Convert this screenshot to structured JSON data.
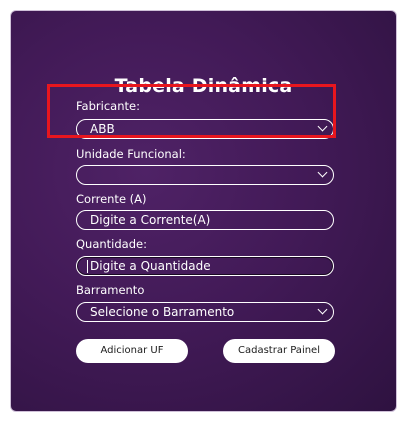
{
  "form": {
    "title": "Tabela Dinâmica",
    "fabricante": {
      "label": "Fabricante:",
      "value": "ABB"
    },
    "unidade": {
      "label": "Unidade Funcional:",
      "value": ""
    },
    "corrente": {
      "label": "Corrente (A)",
      "placeholder": "Digite a Corrente(A)"
    },
    "quantidade": {
      "label": "Quantidade:",
      "placeholder": "Digite a Quantidade"
    },
    "barramento": {
      "label": "Barramento",
      "value": "Selecione o Barramento"
    }
  },
  "buttons": {
    "add": "Adicionar UF",
    "register": "Cadastrar Painel"
  },
  "colors": {
    "highlight": "#e8161e",
    "panel": "#421a57"
  }
}
